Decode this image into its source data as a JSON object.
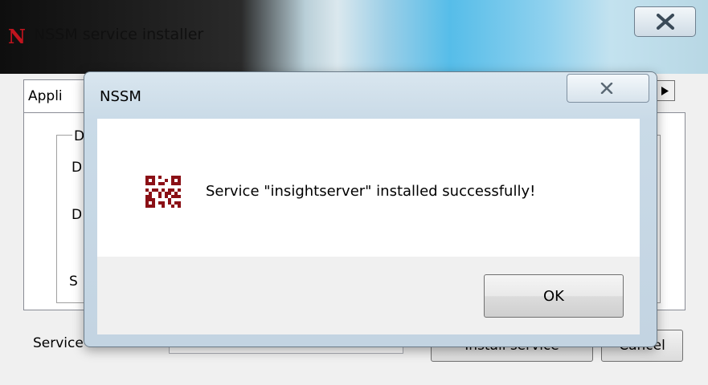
{
  "parent_window": {
    "app_icon_letter": "N",
    "title": "NSSM service installer",
    "first_tab_label": "Appli",
    "group_letters": [
      "D",
      "D",
      "D",
      "S"
    ],
    "service_name_label": "Service name:",
    "install_button_label": "Install service",
    "cancel_button_label": "Cancel",
    "brand_color": "#c0141e"
  },
  "dialog": {
    "title": "NSSM",
    "icon": "qr-code-icon",
    "message": "Service \"insightserver\" installed successfully!",
    "ok_label": "OK"
  }
}
